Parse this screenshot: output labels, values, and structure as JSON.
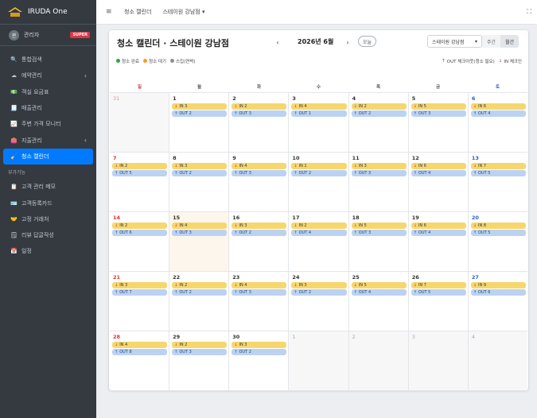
{
  "app": {
    "name": "IRUDA One"
  },
  "user": {
    "avatar_initial": "관",
    "name": "관리자",
    "badge": "SUPER"
  },
  "sidebar": {
    "items": [
      {
        "label": "통합검색",
        "icon": "search-icon",
        "glyph": "🔍"
      },
      {
        "label": "예약관리",
        "icon": "cloud-icon",
        "glyph": "☁",
        "chevron": "‹"
      },
      {
        "label": "객실 요금표",
        "icon": "money-icon",
        "glyph": "💵"
      },
      {
        "label": "매출관리",
        "icon": "receipt-icon",
        "glyph": "🧾"
      },
      {
        "label": "주변 가격 모니터",
        "icon": "chart-line-icon",
        "glyph": "📈"
      },
      {
        "label": "지출관리",
        "icon": "wallet-icon",
        "glyph": "👛",
        "chevron": "‹"
      },
      {
        "label": "청소 캘린더",
        "icon": "broom-icon",
        "glyph": "🧹",
        "active": true
      }
    ],
    "section_header": "부가기능",
    "extra_items": [
      {
        "label": "고객 관리 메모",
        "icon": "clipboard-icon",
        "glyph": "📋"
      },
      {
        "label": "고객등록카드",
        "icon": "id-card-icon",
        "glyph": "🪪"
      },
      {
        "label": "고정 거래처",
        "icon": "handshake-icon",
        "glyph": "🤝"
      },
      {
        "label": "리뷰 답글작성",
        "icon": "notepad-icon",
        "glyph": "🗒"
      },
      {
        "label": "일정",
        "icon": "calendar-icon",
        "glyph": "📅"
      }
    ]
  },
  "topbar": {
    "menu_glyph": "≡",
    "link1": "청소 캘린더",
    "link2": "스테이원 강남점 ▾",
    "expand_glyph": "⛶"
  },
  "calendar": {
    "title": "청소 캘린더 · 스테이원 강남점",
    "prev": "‹",
    "next": "›",
    "month": "2026년 6월",
    "today_label": "오늘",
    "branch_select": "스테이원 강남점",
    "branch_caret": "▾",
    "view_week": "주간",
    "view_month": "월간",
    "legend": [
      {
        "label": "청소 완료",
        "color": "#28a745"
      },
      {
        "label": "청소 대기",
        "color": "#fd9a1b"
      },
      {
        "label": "스킵(연박)",
        "color": "#8a9099"
      }
    ],
    "legend_right": {
      "out_arrow": "↑",
      "out_label": "OUT 체크아웃(청소 필요)",
      "in_arrow": "↓",
      "in_label": "IN 체크인"
    },
    "weekdays": [
      "일",
      "월",
      "화",
      "수",
      "목",
      "금",
      "토"
    ],
    "in_glyph": "↓",
    "out_glyph": "↑",
    "weeks": [
      [
        {
          "n": "31",
          "other": true
        },
        {
          "n": "1",
          "in": "IN 3",
          "out": "OUT 2"
        },
        {
          "n": "2",
          "in": "IN 2",
          "out": "OUT 3"
        },
        {
          "n": "3",
          "in": "IN 4",
          "out": "OUT 1"
        },
        {
          "n": "4",
          "in": "IN 2",
          "out": "OUT 2"
        },
        {
          "n": "5",
          "in": "IN 5",
          "out": "OUT 3"
        },
        {
          "n": "6",
          "in": "IN 6",
          "out": "OUT 4"
        }
      ],
      [
        {
          "n": "7",
          "in": "IN 2",
          "out": "OUT 5"
        },
        {
          "n": "8",
          "in": "IN 3",
          "out": "OUT 2"
        },
        {
          "n": "9",
          "in": "IN 4",
          "out": "OUT 3"
        },
        {
          "n": "10",
          "in": "IN 1",
          "out": "OUT 2"
        },
        {
          "n": "11",
          "in": "IN 3",
          "out": "OUT 3"
        },
        {
          "n": "12",
          "in": "IN 6",
          "out": "OUT 4"
        },
        {
          "n": "13",
          "in": "IN 7",
          "out": "OUT 5"
        }
      ],
      [
        {
          "n": "14",
          "in": "IN 2",
          "out": "OUT 6"
        },
        {
          "n": "15",
          "in": "IN 4",
          "out": "OUT 3",
          "today": true
        },
        {
          "n": "16",
          "in": "IN 3",
          "out": "OUT 2"
        },
        {
          "n": "17",
          "in": "IN 2",
          "out": "OUT 4"
        },
        {
          "n": "18",
          "in": "IN 5",
          "out": "OUT 3"
        },
        {
          "n": "19",
          "in": "IN 6",
          "out": "OUT 4"
        },
        {
          "n": "20",
          "in": "IN 8",
          "out": "OUT 5"
        }
      ],
      [
        {
          "n": "21",
          "in": "IN 3",
          "out": "OUT 7"
        },
        {
          "n": "22",
          "in": "IN 2",
          "out": "OUT 2"
        },
        {
          "n": "23",
          "in": "IN 4",
          "out": "OUT 3"
        },
        {
          "n": "24",
          "in": "IN 3",
          "out": "OUT 2"
        },
        {
          "n": "25",
          "in": "IN 5",
          "out": "OUT 4"
        },
        {
          "n": "26",
          "in": "IN 7",
          "out": "OUT 5"
        },
        {
          "n": "27",
          "in": "IN 9",
          "out": "OUT 6"
        }
      ],
      [
        {
          "n": "28",
          "in": "IN 4",
          "out": "OUT 8"
        },
        {
          "n": "29",
          "in": "IN 2",
          "out": "OUT 3"
        },
        {
          "n": "30",
          "in": "IN 3",
          "out": "OUT 2"
        },
        {
          "n": "1",
          "other": true
        },
        {
          "n": "2",
          "other": true
        },
        {
          "n": "3",
          "other": true
        },
        {
          "n": "4",
          "other": true
        }
      ]
    ]
  }
}
